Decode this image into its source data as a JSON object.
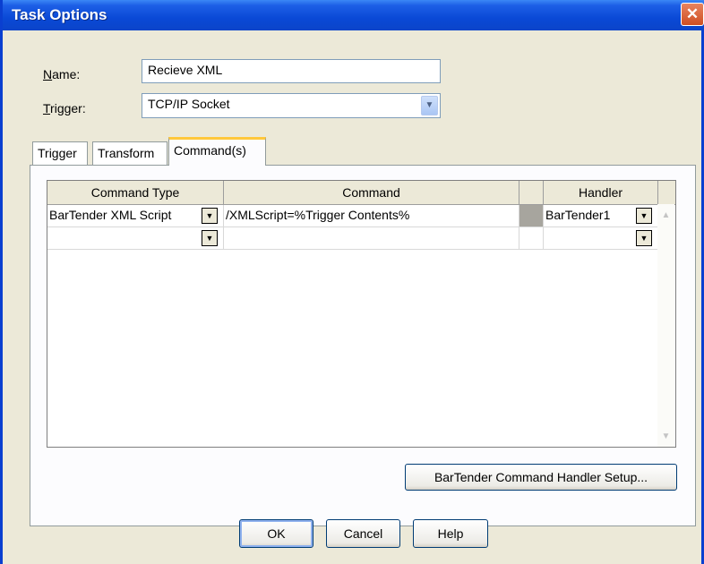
{
  "window": {
    "title": "Task Options",
    "close_glyph": "✕"
  },
  "form": {
    "name_label_u": "N",
    "name_label_rest": "ame:",
    "name_value": "Recieve XML",
    "trigger_label_u": "T",
    "trigger_label_rest": "rigger:",
    "trigger_value": "TCP/IP Socket"
  },
  "tabs": [
    "Trigger",
    "Transform",
    "Command(s)"
  ],
  "active_tab": "Command(s)",
  "grid": {
    "columns": [
      "Command Type",
      "Command",
      "",
      "Handler"
    ],
    "rows": [
      {
        "command_type": "BarTender XML Script",
        "command": "/XMLScript=%Trigger Contents%",
        "handler": "BarTender1"
      },
      {
        "command_type": "",
        "command": "",
        "handler": ""
      }
    ]
  },
  "buttons": {
    "handler_setup": "BarTender Command Handler Setup...",
    "ok": "OK",
    "cancel": "Cancel",
    "help": "Help"
  },
  "icons": {
    "dropdown": "chevron-down-icon",
    "scroll_up": "chevron-up-icon",
    "scroll_down": "chevron-down-icon",
    "close": "close-icon"
  },
  "colors": {
    "title_bar": "#0a49d6",
    "close_button": "#d04e22",
    "active_tab_accent": "#ffc83c",
    "dialog_bg": "#ece9d8"
  }
}
